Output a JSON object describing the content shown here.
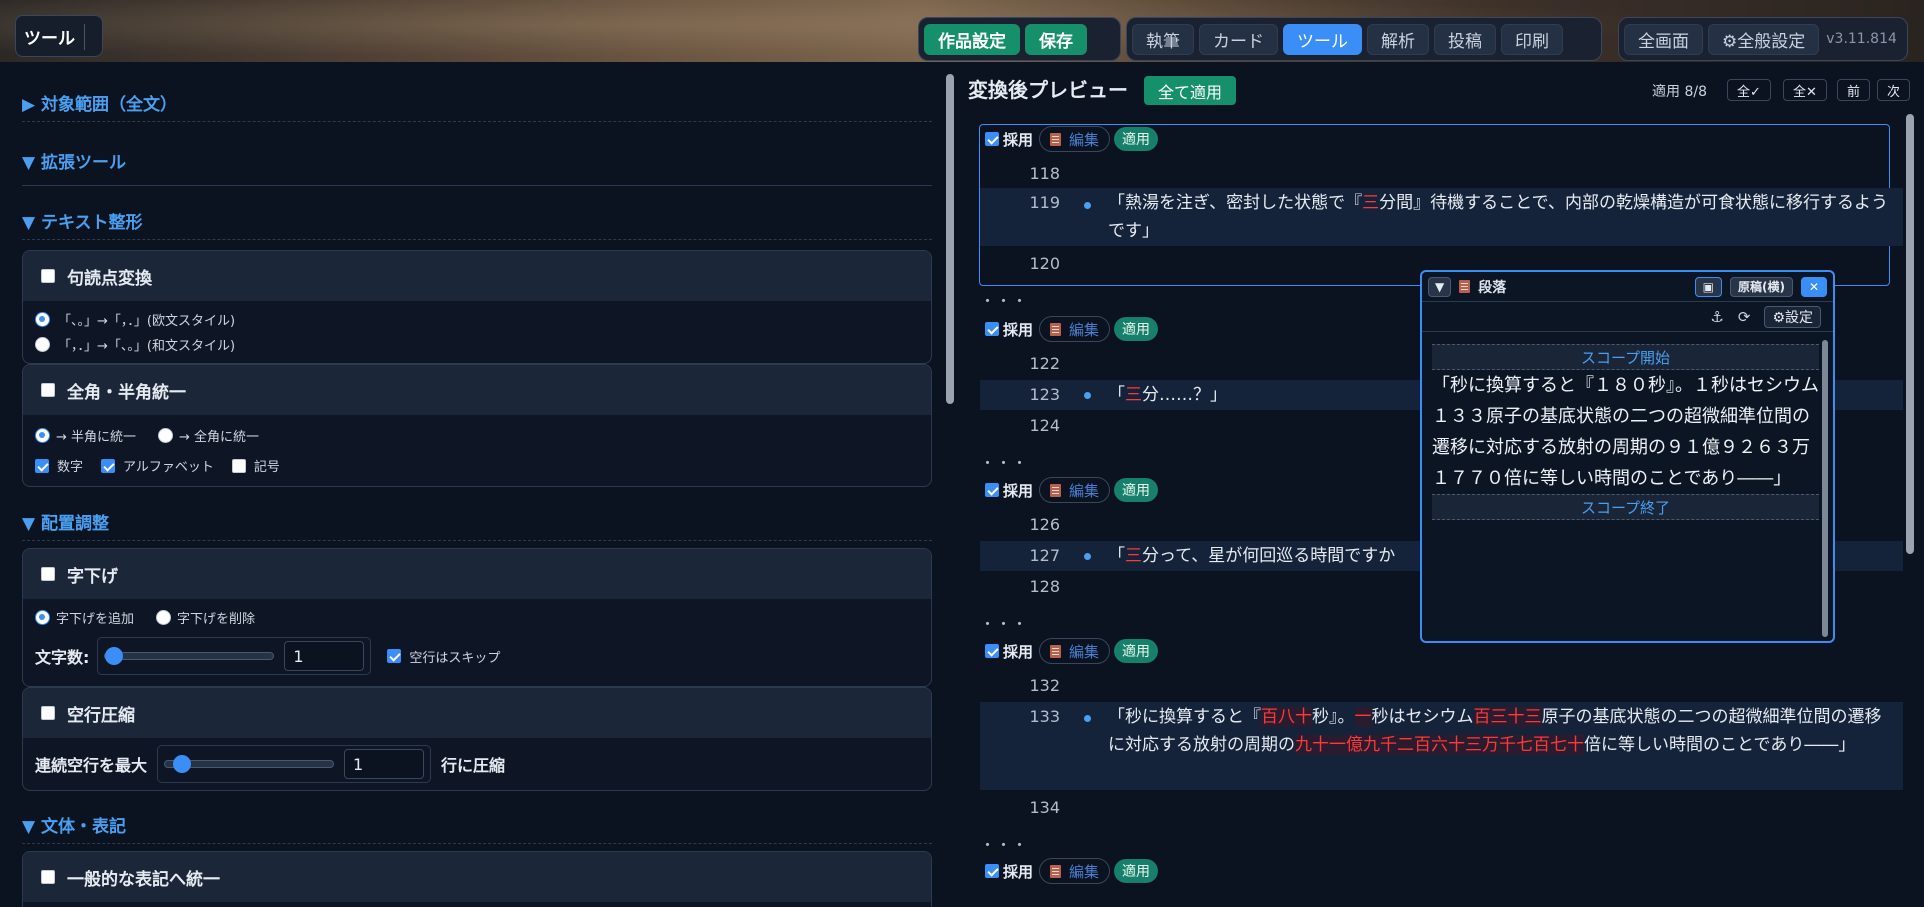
{
  "header": {
    "panel_label": "ツール",
    "project_buttons": [
      "作品設定",
      "保存"
    ],
    "tabs": [
      "執筆",
      "カード",
      "ツール",
      "解析",
      "投稿",
      "印刷"
    ],
    "active_tab_index": 2,
    "fullscreen": "全画面",
    "settings": "⚙全般設定",
    "version": "v3.11.814"
  },
  "left": {
    "scope_section": "▶ 対象範囲（全文）",
    "ext_section": "▼ 拡張ツール",
    "text_section": "▼ テキスト整形",
    "punct": {
      "title": "句読点変換",
      "opt1": "「、。」→「，．」(欧文スタイル)",
      "opt2": "「，．」→「、。」(和文スタイル)"
    },
    "width": {
      "title": "全角・半角統一",
      "to_half": "→ 半角に統一",
      "to_full": "→ 全角に統一",
      "digits": "数字",
      "alpha": "アルファベット",
      "symbols": "記号"
    },
    "layout_section": "▼ 配置調整",
    "indent": {
      "title": "字下げ",
      "add": "字下げを追加",
      "remove": "字下げを削除",
      "count_label": "文字数:",
      "count_value": "1",
      "skip_blank": "空行はスキップ"
    },
    "blank": {
      "title": "空行圧縮",
      "max_label": "連続空行を最大",
      "max_value": "1",
      "suffix": "行に圧縮"
    },
    "style_section": "▼ 文体・表記",
    "normalize": {
      "title": "一般的な表記へ統一"
    }
  },
  "preview": {
    "title": "変換後プレビュー",
    "apply_all": "全て適用",
    "applied": "適用 8/8",
    "all_check": "全✓",
    "all_clear": "全✕",
    "prev": "前",
    "next": "次",
    "adopt": "採用",
    "edit": "編集",
    "applied_tag": "適用",
    "ellipsis": "・・・",
    "lines": {
      "l118": "118",
      "l119": "119",
      "t119_a": "「熱湯を注ぎ、密封した状態で『",
      "t119_r": "三",
      "t119_b": "分間』待機することで、内部の乾燥構造が可食状態に移行するようです」",
      "l120": "120",
      "l122": "122",
      "l123": "123",
      "t123_a": "「",
      "t123_r": "三",
      "t123_b": "分……？」",
      "l124": "124",
      "l126": "126",
      "l127": "127",
      "t127_a": "「",
      "t127_r": "三",
      "t127_b": "分って、星が何回巡る時間ですか",
      "l128": "128",
      "l132": "132",
      "l133": "133",
      "t133_1": "「秒に換算すると『",
      "t133_2": "百八十",
      "t133_3": "秒』。",
      "t133_4": "一",
      "t133_5": "秒はセシウム",
      "t133_6": "百三十三",
      "t133_7": "原子の基底状態の二つの超微細準位間の遷移に対応する放射の周期の",
      "t133_8": "九十一億九千二百六十三万千七百七十",
      "t133_9": "倍に等しい時間のことであり――」",
      "l134": "134"
    }
  },
  "popup": {
    "title": "段落",
    "mode": "原稿(横)",
    "settings": "⚙設定",
    "scope_start": "スコープ開始",
    "scope_end": "スコープ終了",
    "text": "「秒に換算すると『１８０秒』。１秒はセシウム１３３原子の基底状態の二つの超微細準位間の遷移に対応する放射の周期の９１億９２６３万１７７０倍に等しい時間のことであり――」"
  }
}
